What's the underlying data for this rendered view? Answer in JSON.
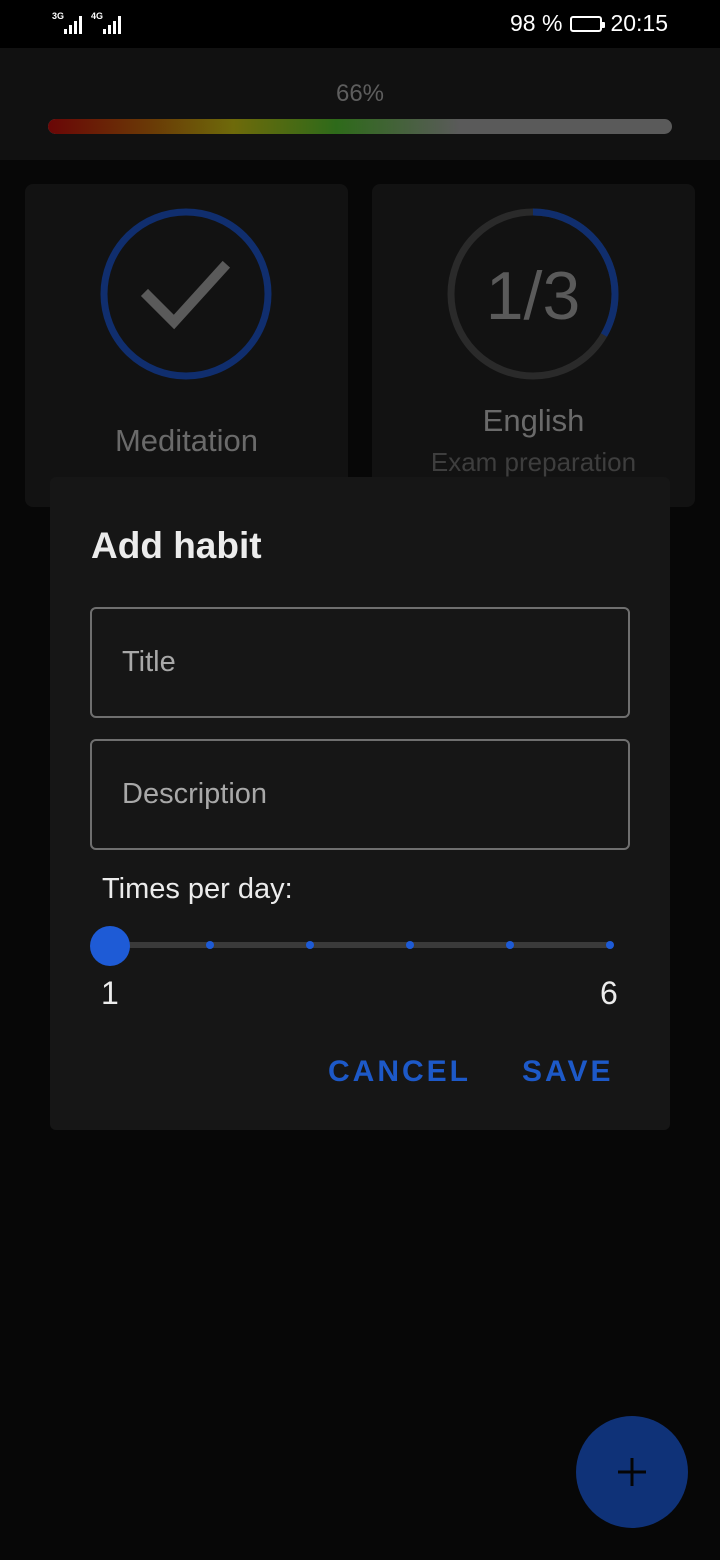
{
  "status_bar": {
    "network_1": "3G",
    "network_2": "4G",
    "battery": "98 %",
    "time": "20:15"
  },
  "overall_progress": {
    "label": "66%",
    "value": 0.66
  },
  "habits": [
    {
      "title": "Meditation",
      "description": "",
      "completed": true,
      "icon": "check-icon",
      "ring_color": "#102e6e"
    },
    {
      "title": "English",
      "description": "Exam preparation",
      "progress_text": "1/3",
      "done": 1,
      "total": 3,
      "ring_color": "#102e6e"
    }
  ],
  "dialog": {
    "title": "Add habit",
    "title_field": {
      "value": "",
      "placeholder": "Title"
    },
    "description_field": {
      "value": "",
      "placeholder": "Description"
    },
    "slider": {
      "label": "Times per day:",
      "min_label": "1",
      "max_label": "6",
      "min": 1,
      "max": 6,
      "value": 1
    },
    "cancel_label": "CANCEL",
    "save_label": "SAVE"
  },
  "fab": {
    "icon": "plus-icon"
  },
  "colors": {
    "accent": "#1e5bd6",
    "background": "#070707",
    "dialog": "#161616"
  }
}
